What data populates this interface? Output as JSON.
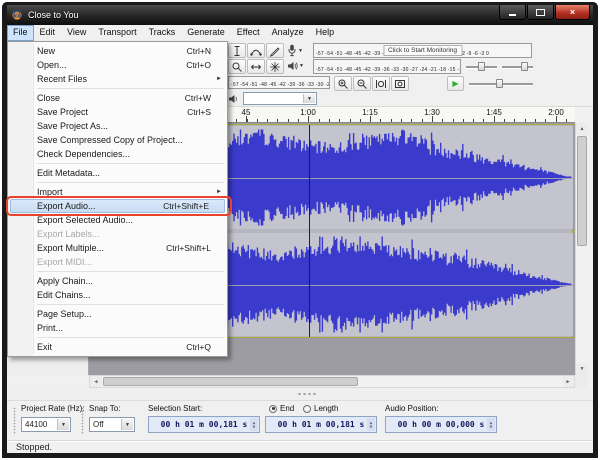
{
  "window": {
    "title": "Close to You"
  },
  "menu_bar": {
    "active": "File",
    "items": [
      "File",
      "Edit",
      "View",
      "Transport",
      "Tracks",
      "Generate",
      "Effect",
      "Analyze",
      "Help"
    ]
  },
  "file_menu": {
    "items": [
      {
        "label": "New",
        "shortcut": "Ctrl+N"
      },
      {
        "label": "Open...",
        "shortcut": "Ctrl+O"
      },
      {
        "label": "Recent Files",
        "submenu": true
      },
      {
        "separator": true
      },
      {
        "label": "Close",
        "shortcut": "Ctrl+W"
      },
      {
        "label": "Save Project",
        "shortcut": "Ctrl+S"
      },
      {
        "label": "Save Project As..."
      },
      {
        "label": "Save Compressed Copy of Project..."
      },
      {
        "label": "Check Dependencies..."
      },
      {
        "separator": true
      },
      {
        "label": "Edit Metadata..."
      },
      {
        "separator": true
      },
      {
        "label": "Import",
        "submenu": true
      },
      {
        "label": "Export Audio...",
        "shortcut": "Ctrl+Shift+E",
        "highlighted": true,
        "annotated": true
      },
      {
        "label": "Export Selected Audio..."
      },
      {
        "label": "Export Labels...",
        "disabled": true
      },
      {
        "label": "Export Multiple...",
        "shortcut": "Ctrl+Shift+L"
      },
      {
        "label": "Export MIDI...",
        "disabled": true
      },
      {
        "separator": true
      },
      {
        "label": "Apply Chain..."
      },
      {
        "label": "Edit Chains..."
      },
      {
        "separator": true
      },
      {
        "label": "Page Setup..."
      },
      {
        "label": "Print..."
      },
      {
        "separator": true
      },
      {
        "label": "Exit",
        "shortcut": "Ctrl+Q"
      }
    ]
  },
  "toolbars": {
    "meter_scale": "-57 -54 -51 -48 -45 -42 -39 -36 -33 -30 -27 -24 -21 -18 -15 -12 -9 -6 -3 0",
    "monitor_label": "Click to Start Monitoring"
  },
  "timeline": {
    "labels": [
      "45",
      "1:00",
      "1:15",
      "1:30",
      "1:45",
      "2:00"
    ]
  },
  "selection_toolbar": {
    "project_rate_label": "Project Rate (Hz):",
    "project_rate_value": "44100",
    "snap_to_label": "Snap To:",
    "snap_to_value": "Off",
    "selection_start_label": "Selection Start:",
    "end_radio_label": "End",
    "length_radio_label": "Length",
    "audio_position_label": "Audio Position:",
    "selection_start_value": "00 h 01 m 00,181 s",
    "selection_end_value": "00 h 01 m 00,181 s",
    "audio_position_value": "00 h 00 m 00,000 s"
  },
  "status_bar": {
    "text": "Stopped."
  },
  "icons": {
    "close": "×",
    "dropdown_arrow": "▼",
    "submenu_arrow": "►",
    "scroll_up": "▲",
    "scroll_down": "▼",
    "scroll_left": "◄",
    "scroll_right": "►",
    "spinner_up": "▲",
    "spinner_down": "▼",
    "play": "▶"
  },
  "colors": {
    "annotation": "#e8432d",
    "waveform": "#3a3acd",
    "waveform_rms": "#8c8cec"
  }
}
